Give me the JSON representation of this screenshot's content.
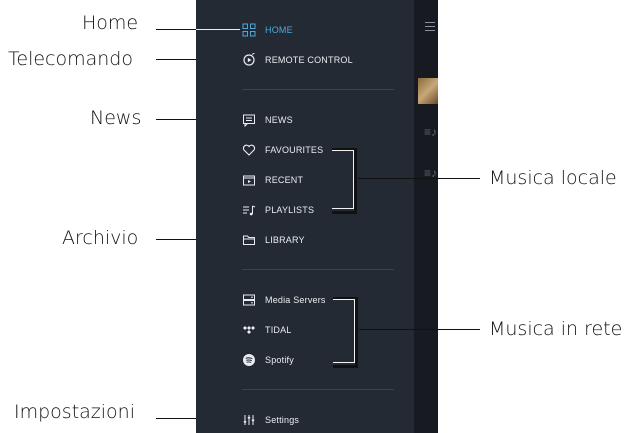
{
  "callouts": {
    "home": "Home",
    "remote": "Telecomando",
    "news": "News",
    "archive": "Archivio",
    "settings": "Impostazioni",
    "local_music": "Musica locale",
    "network_music": "Musica in rete"
  },
  "menu": {
    "home": "HOME",
    "remote_control": "REMOTE CONTROL",
    "news": "NEWS",
    "favourites": "FAVOURITES",
    "recent": "RECENT",
    "playlists": "PLAYLISTS",
    "library": "LIBRARY",
    "media_servers": "Media Servers",
    "tidal": "TIDAL",
    "spotify": "Spotify",
    "settings": "Settings"
  },
  "colors": {
    "panel": "#232a33",
    "active": "#4ea8de"
  },
  "icons": [
    "grid-icon",
    "remote-icon",
    "news-icon",
    "heart-icon",
    "recent-icon",
    "playlist-icon",
    "folder-icon",
    "server-icon",
    "tidal-icon",
    "spotify-icon",
    "sliders-icon",
    "hamburger-icon"
  ]
}
